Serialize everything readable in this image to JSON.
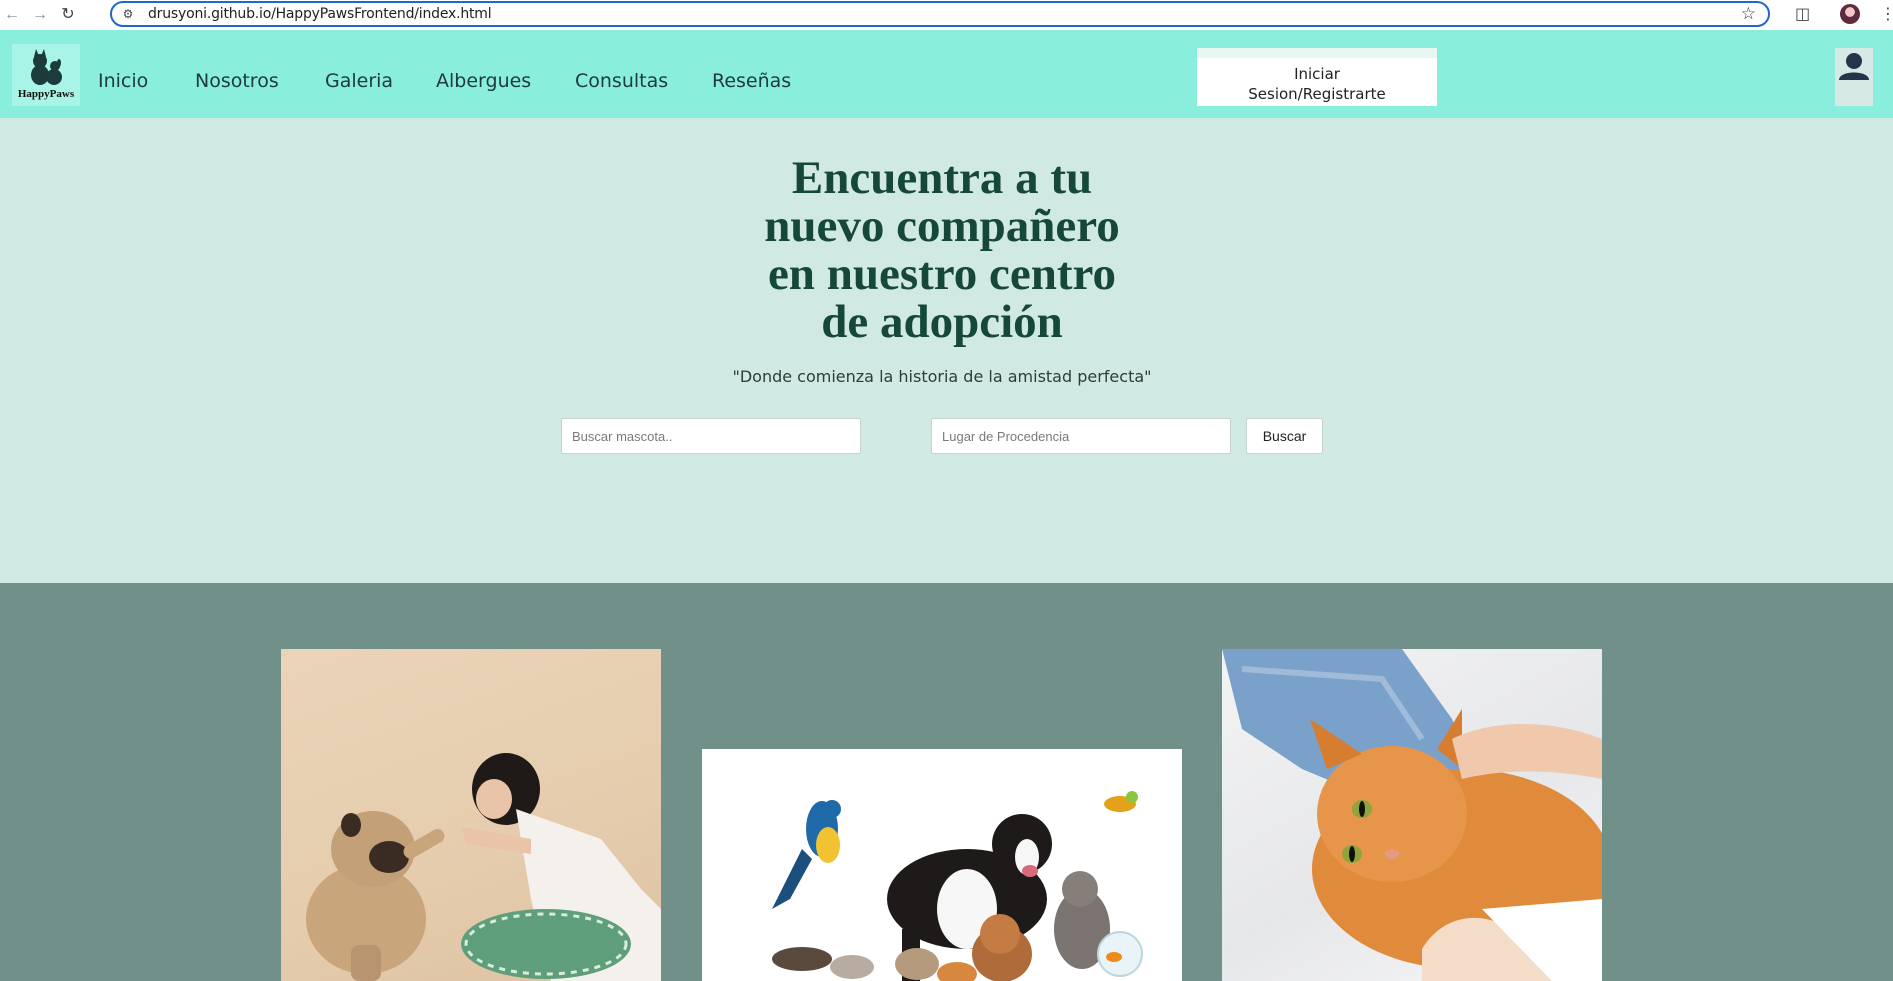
{
  "browser": {
    "url": "drusyoni.github.io/HappyPawsFrontend/index.html"
  },
  "header": {
    "logo_text": "HappyPaws",
    "menu": [
      {
        "label": "Inicio"
      },
      {
        "label": "Nosotros"
      },
      {
        "label": "Galeria"
      },
      {
        "label": "Albergues"
      },
      {
        "label": "Consultas"
      },
      {
        "label": "Reseñas"
      }
    ],
    "login_line1": "Iniciar",
    "login_line2": "Sesion/Registrarte"
  },
  "hero": {
    "title_lines": [
      "Encuentra a tu",
      "nuevo compañero",
      "en nuestro centro",
      "de adopción"
    ],
    "tagline": "\"Donde comienza la historia de la amistad perfecta\"",
    "search_placeholder": "Buscar mascota..",
    "origin_placeholder": "Lugar de Procedencia",
    "search_button": "Buscar"
  },
  "colors": {
    "header_bg": "#89eedb",
    "hero_bg": "#d1e9e3",
    "gallery_bg": "#72908a",
    "title_color": "#16483a"
  }
}
